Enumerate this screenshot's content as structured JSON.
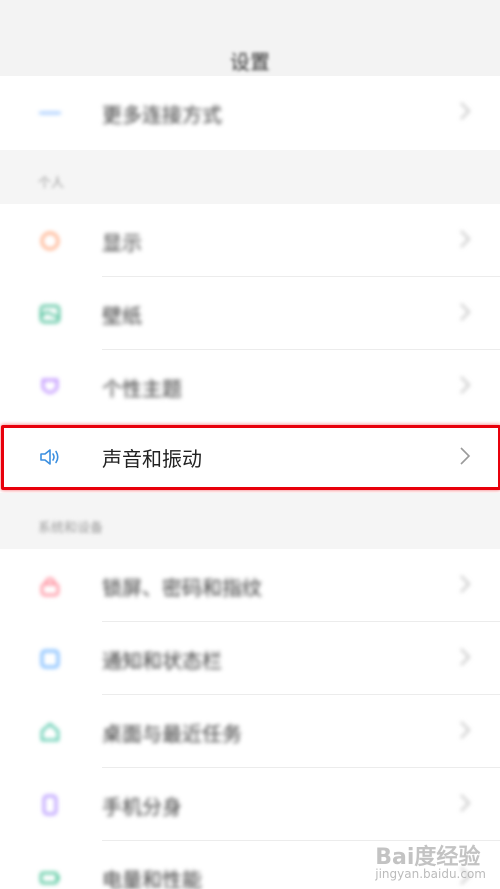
{
  "header": {
    "title": "设置"
  },
  "top_item": {
    "label": "更多连接方式",
    "icon": "more-connections-icon",
    "color": "#7fb6ff"
  },
  "sections": {
    "personal": "个人",
    "system": "系统和设备"
  },
  "personal_items": [
    {
      "label": "显示",
      "icon": "display-icon",
      "color": "#ff9a6b"
    },
    {
      "label": "壁纸",
      "icon": "wallpaper-icon",
      "color": "#39b98e"
    },
    {
      "label": "个性主题",
      "icon": "theme-icon",
      "color": "#b27cff"
    },
    {
      "label": "声音和振动",
      "icon": "sound-vibration-icon",
      "color": "#3b8fe0"
    }
  ],
  "system_items": [
    {
      "label": "锁屏、密码和指纹",
      "icon": "lock-icon",
      "color": "#ff7d8e"
    },
    {
      "label": "通知和状态栏",
      "icon": "notification-icon",
      "color": "#5aa9ff"
    },
    {
      "label": "桌面与最近任务",
      "icon": "home-icon",
      "color": "#45c3a3"
    },
    {
      "label": "手机分身",
      "icon": "phone-clone-icon",
      "color": "#a884ff"
    },
    {
      "label": "电量和性能",
      "icon": "battery-icon",
      "color": "#3bbf8f"
    }
  ],
  "highlight_color": "#e8000b",
  "watermark": {
    "main": "Bai度经验",
    "sub": "jingyan.baidu.com"
  }
}
